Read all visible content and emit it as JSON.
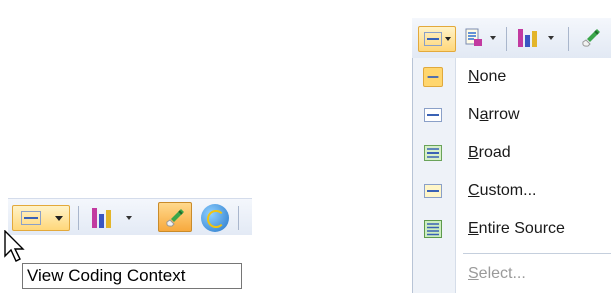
{
  "left_toolbar": {
    "tooltip": "View Coding Context"
  },
  "coding_context_menu": {
    "items": [
      {
        "label": "None",
        "mnemonic": "N",
        "rest": "one",
        "selected": true,
        "enabled": true
      },
      {
        "label": "Narrow",
        "mnemonic": "a",
        "pre": "N",
        "rest": "rrow",
        "selected": false,
        "enabled": true
      },
      {
        "label": "Broad",
        "mnemonic": "B",
        "rest": "road",
        "selected": false,
        "enabled": true
      },
      {
        "label": "Custom...",
        "mnemonic": "C",
        "rest": "ustom...",
        "selected": false,
        "enabled": true
      },
      {
        "label": "Entire Source",
        "mnemonic": "E",
        "rest": "ntire Source",
        "selected": false,
        "enabled": true
      },
      {
        "label": "Select...",
        "mnemonic": "S",
        "rest": "elect...",
        "selected": false,
        "enabled": false
      }
    ]
  },
  "colors": {
    "highlight": "#ffd77a",
    "highlight_border": "#e3a93b",
    "bar_magenta": "#c23aa0",
    "bar_blue": "#3a56c2",
    "bar_gold": "#e3b52a",
    "disabled_text": "#9a9a9a"
  },
  "icons": [
    "coding-context-icon",
    "chevron-down-icon",
    "coding-stripes-icon",
    "highlight-brush-icon",
    "web-globe-icon",
    "document-icon",
    "mouse-cursor-icon"
  ]
}
